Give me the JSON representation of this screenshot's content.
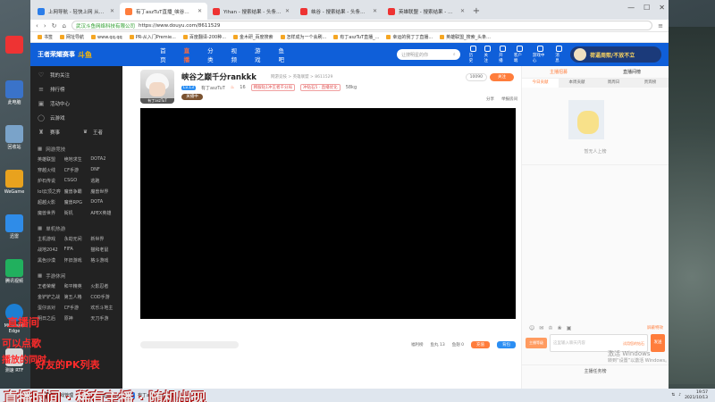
{
  "browser": {
    "tabs": [
      {
        "label": "上网导航 - 轻快上网 从这里开始",
        "active": false,
        "color": "#2b7de9"
      },
      {
        "label": "有丁aszTuT直播_峡谷之巅千分rankkk直播_斗鱼直播",
        "active": true,
        "color": "#ff7d3c"
      },
      {
        "label": "Yihan - 搜索结果 - 头条直播",
        "active": false,
        "color": "#e33"
      },
      {
        "label": "峡谷 - 搜索结果 - 头条直播 - 游戏区",
        "active": false,
        "color": "#e33"
      },
      {
        "label": "英雄联盟 - 搜索结果 - 头条直播 - 游戏区",
        "active": false,
        "color": "#e33"
      }
    ],
    "new_tab": "+",
    "window_controls": [
      "—",
      "☐",
      "✕"
    ],
    "site_name": "武汉斗鱼网络科技有限公司",
    "url": "https://www.douyu.com/8611529",
    "bookmarks": [
      "书签",
      "网址导航",
      "www.qq.qq",
      "PR-从入门Premie...",
      "百度翻译-200种...",
      "金木研_百度搜索",
      "怎样成为一个会刷...",
      "有丁aszTuT直播_...",
      "幸运的我丁丁直播...",
      "英雄联盟_搜索_头条..."
    ]
  },
  "header": {
    "logo_text": "王者荣耀赛事",
    "logo_brand": "斗鱼",
    "nav": [
      "首页",
      "直播",
      "分类",
      "视频",
      "游戏",
      "鱼吧"
    ],
    "active_nav": "直播",
    "search_placeholder": "让搜明星的你",
    "icons": [
      "历史",
      "关注",
      "开播",
      "客户端",
      "游戏中心",
      "消息"
    ],
    "banner_text": "荷逼周熙/不放不立"
  },
  "sidebar": {
    "top_items": [
      {
        "icon": "♡",
        "label": "我的关注"
      },
      {
        "icon": "≡",
        "label": "排行榜"
      },
      {
        "icon": "▣",
        "label": "活动中心"
      },
      {
        "icon": "◯",
        "label": "云游戏"
      }
    ],
    "special": {
      "left": "赛事",
      "mid": "♛",
      "right": "王者"
    },
    "sections": [
      {
        "title": "网游竞技",
        "items": [
          "英雄联盟",
          "绝地求生",
          "DOTA2",
          "穿越火线",
          "CF手游",
          "DNF",
          "炉石传说",
          "CSGO",
          "逃跑",
          "lol云顶之弈",
          "魔兽争霸",
          "魔兽世界",
          "超越火影",
          "魔兽RPG",
          "DOTA",
          "魔兽世界",
          "街机",
          "APEX英雄"
        ]
      },
      {
        "title": "单机热游",
        "items": [
          "主机游戏",
          "永劫无间",
          "新世界",
          "战地2042",
          "FIFA",
          "猫和老鼠",
          "黑色沙漠",
          "怀旧游戏",
          "格斗游戏"
        ]
      },
      {
        "title": "手游休闲",
        "items": [
          "王者荣耀",
          "和平精英",
          "火影忍者",
          "金铲铲之战",
          "第五人格",
          "COD手游",
          "蛋仔派对",
          "CF手游",
          "欢乐斗地主",
          "明日之后",
          "原神",
          "天刀手游"
        ]
      }
    ]
  },
  "room": {
    "title": "峡谷之巅千分rankkk",
    "meta": "网游竞技 > 英雄联盟 > 8611529",
    "level": "Lv.13",
    "streamer": "有丁aszTuT",
    "hot": "16",
    "tag1": "韩服钻1冲王者千分局",
    "tag2": "冲钻石5 · 直播优化",
    "fans_club": "58kg",
    "room_button": "关播中",
    "avatar_caption": "有丁aszTuT",
    "follow_count": "10090",
    "follow_label": "关注",
    "share": "分享",
    "report": "举报房间",
    "below": {
      "left1": "福利榜",
      "left2": "鱼丸 13",
      "left3": "鱼翅 0",
      "btn1": "充值",
      "btn2": "背包"
    }
  },
  "chat": {
    "rank_left": "主播招募",
    "rank_right": "直播间榜",
    "rank_tabs": [
      "今日贡献",
      "本周贡献",
      "周周日",
      "贵宾榜",
      "贵宾活动"
    ],
    "empty_caption": "暂无人上榜",
    "clear_label": "屏蔽特效",
    "level_label": "主播等级",
    "input_placeholder": "这里输入聊天内容",
    "input_hint": "试用您的钻石",
    "send": "发送",
    "bottom": "主播任务榜"
  },
  "watermark": {
    "line1": "激活 Windows",
    "line2": "转到“设置”以激活 Windows。"
  },
  "taskbar": {
    "items": [
      "",
      "e",
      "游戏管理",
      "斗鱼直播中心",
      "有丁aszTuT直播..."
    ],
    "time": "19:57",
    "date": "2021/10/13"
  },
  "desktop": {
    "icons": [
      "",
      "此电脑",
      "回收站",
      "WeGame",
      "迅雷",
      "腾讯视频",
      "Microsoft Edge",
      "测速 RTF"
    ],
    "captions": {
      "c1": "直播间",
      "c2": "可以点歌",
      "c3": "播放的同时",
      "c4": "好友的PK列表",
      "bottom": "直播时间 · 稀有主播 · 随机出现"
    }
  }
}
